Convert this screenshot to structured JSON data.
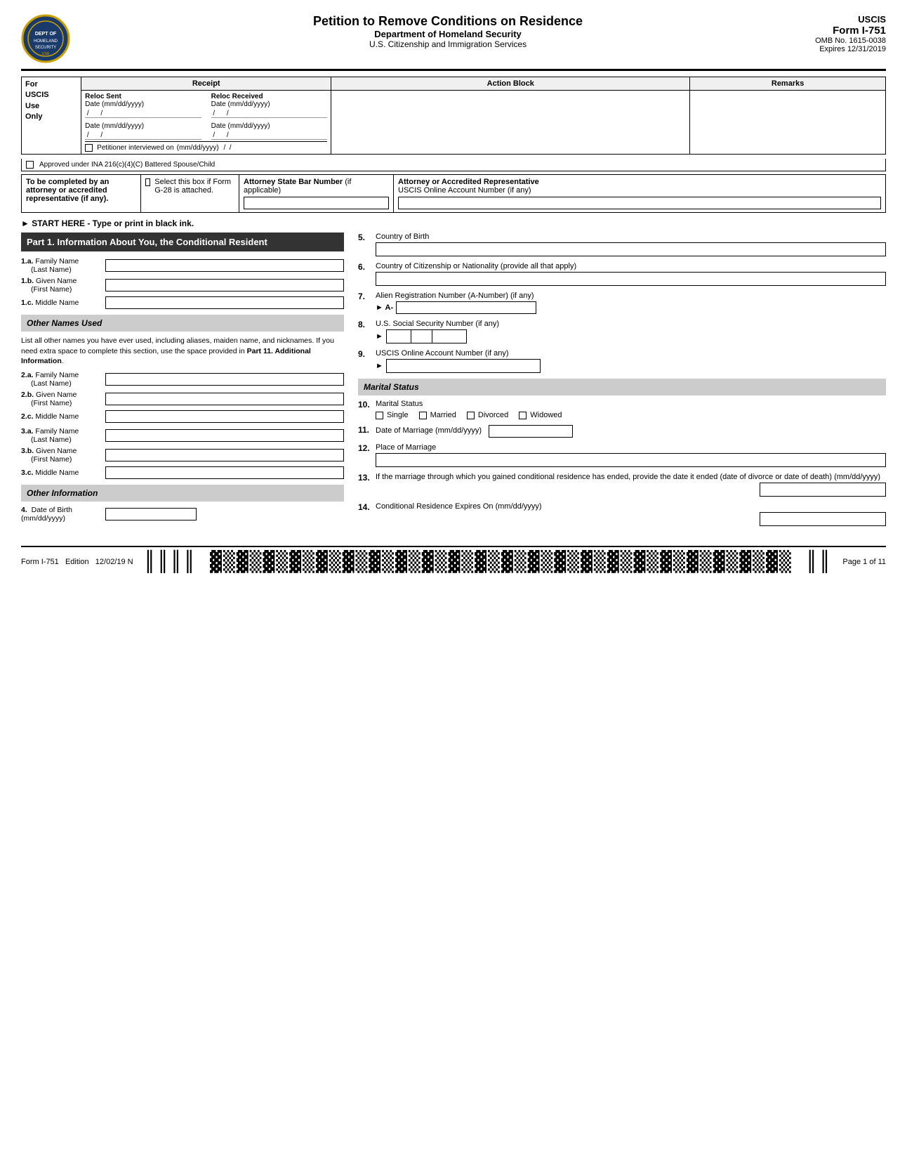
{
  "header": {
    "title": "Petition to Remove Conditions on Residence",
    "subtitle": "Department of Homeland Security",
    "subtitle2": "U.S. Citizenship and Immigration Services",
    "form_id": "USCIS",
    "form_num": "Form I-751",
    "omb": "OMB No. 1615-0038",
    "expires": "Expires 12/31/2019"
  },
  "top_table": {
    "receipt_label": "Receipt",
    "action_block_label": "Action Block",
    "remarks_label": "Remarks",
    "for_uscis_label": "For\nUSCIS\nUse\nOnly",
    "reloc_sent_label": "Reloc Sent",
    "reloc_received_label": "Reloc Received",
    "date_label": "Date (mm/dd/yyyy)",
    "petitioner_label": "Petitioner interviewed on",
    "petitioner_date_fmt": "(mm/dd/yyyy)",
    "approved_label": "Approved under INA 216(c)(4)(C) Battered Spouse/Child"
  },
  "attorney_section": {
    "to_be_completed_label": "To be completed by an attorney or accredited representative (if any).",
    "select_box_label": "Select this box if Form G-28 is attached.",
    "atty_bar_label": "Attorney State Bar Number",
    "atty_bar_sub": "(if applicable)",
    "atty_rep_label": "Attorney or Accredited Representative",
    "atty_rep_sub": "USCIS Online Account Number (if any)"
  },
  "start_here": "START HERE - Type or print in black ink.",
  "part1": {
    "header": "Part 1.  Information About You, the Conditional Resident",
    "fields": [
      {
        "num": "1.a.",
        "label": "Family Name\n(Last Name)"
      },
      {
        "num": "1.b.",
        "label": "Given Name\n(First Name)"
      },
      {
        "num": "1.c.",
        "label": "Middle Name"
      }
    ],
    "other_names_header": "Other Names Used",
    "other_names_desc": "List all other names you have ever used, including aliases, maiden name, and nicknames.  If you need extra space to complete this section, use the space provided in Part 11. Additional Information.",
    "other_name_fields_2": [
      {
        "num": "2.a.",
        "label": "Family Name\n(Last Name)"
      },
      {
        "num": "2.b.",
        "label": "Given Name\n(First Name)"
      },
      {
        "num": "2.c.",
        "label": "Middle Name"
      }
    ],
    "other_name_fields_3": [
      {
        "num": "3.a.",
        "label": "Family Name\n(Last Name)"
      },
      {
        "num": "3.b.",
        "label": "Given Name\n(First Name)"
      },
      {
        "num": "3.c.",
        "label": "Middle Name"
      }
    ],
    "other_info_header": "Other Information",
    "q4_label": "Date of Birth (mm/dd/yyyy)",
    "q4_num": "4."
  },
  "right_col": {
    "q5_num": "5.",
    "q5_label": "Country of Birth",
    "q6_num": "6.",
    "q6_label": "Country of Citizenship or Nationality (provide all that apply)",
    "q7_num": "7.",
    "q7_label": "Alien Registration Number (A-Number) (if any)",
    "q7_prefix": "► A-",
    "q8_num": "8.",
    "q8_label": "U.S. Social Security Number (if any)",
    "q8_arrow": "►",
    "q9_num": "9.",
    "q9_label": "USCIS Online Account Number (if any)",
    "q9_arrow": "►",
    "marital_header": "Marital Status",
    "q10_num": "10.",
    "q10_label": "Marital Status",
    "marital_options": [
      "Single",
      "Married",
      "Divorced",
      "Widowed"
    ],
    "q11_num": "11.",
    "q11_label": "Date of Marriage (mm/dd/yyyy)",
    "q12_num": "12.",
    "q12_label": "Place of Marriage",
    "q13_num": "13.",
    "q13_label": "If the marriage through which you gained conditional residence has ended, provide the date it ended (date of divorce or date of death) (mm/dd/yyyy)",
    "q14_num": "14.",
    "q14_label": "Conditional Residence Expires On (mm/dd/yyyy)"
  },
  "footer": {
    "form_label": "Form I-751",
    "edition_label": "Edition",
    "edition_date": "12/02/19 N",
    "page_label": "Page 1 of 11"
  }
}
